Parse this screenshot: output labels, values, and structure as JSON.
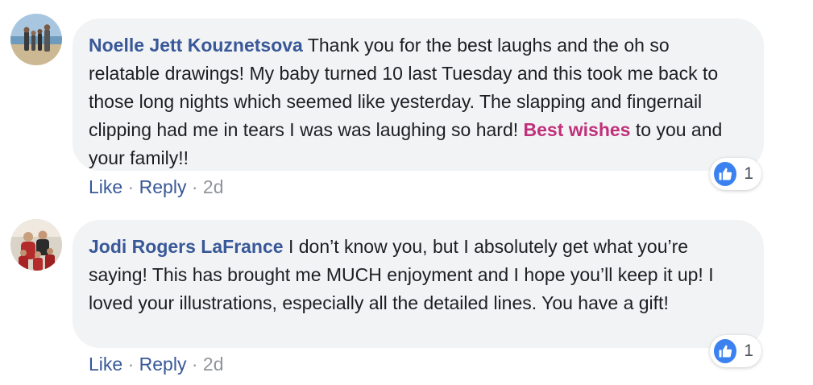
{
  "comments": [
    {
      "author": "Noelle Jett Kouznetsova",
      "text_before": " Thank you for the best laughs and the oh so relatable drawings! My baby turned 10 last Tuesday and this took me back to those long nights which seemed like yesterday. The slapping and fingernail clipping had me in tears I was was laughing so hard! ",
      "tag": "Best wishes",
      "text_after": " to you and your family!!",
      "actions": {
        "like": "Like",
        "reply": "Reply",
        "separator": "·",
        "time": "2d"
      },
      "reactions": {
        "icon": "thumbs-up-icon",
        "count": "1"
      }
    },
    {
      "author": "Jodi Rogers LaFrance",
      "text_before": " I don’t know you, but I absolutely get what you’re saying! This has brought me MUCH enjoyment and I hope you’ll keep it up! I loved your illustrations, especially all the detailed lines. You have a gift!",
      "tag": "",
      "text_after": "",
      "actions": {
        "like": "Like",
        "reply": "Reply",
        "separator": "·",
        "time": "2d"
      },
      "reactions": {
        "icon": "thumbs-up-icon",
        "count": "1"
      }
    }
  ],
  "colors": {
    "author": "#385898",
    "tag": "#c0307a",
    "bubble": "#f2f3f5",
    "like_reaction": "#3b82f0",
    "timestamp": "#90949c"
  }
}
